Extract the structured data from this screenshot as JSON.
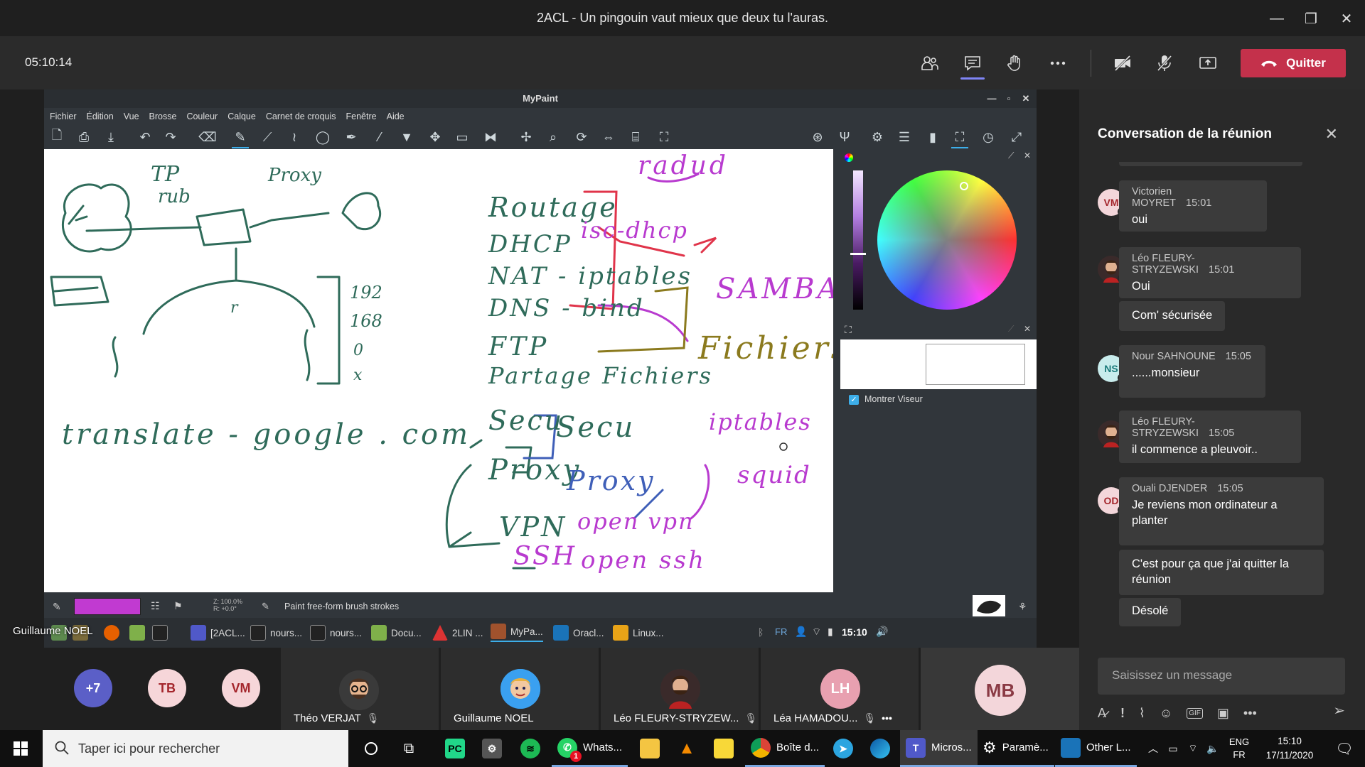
{
  "window": {
    "title": "2ACL - Un pingouin vaut mieux que deux tu l'auras.",
    "minimize_glyph": "—",
    "maximize_glyph": "❐",
    "close_glyph": "✕"
  },
  "meeting": {
    "timer": "05:10:14",
    "quit_label": "Quitter"
  },
  "mypaint": {
    "title": "MyPaint",
    "menu": [
      "Fichier",
      "Édition",
      "Vue",
      "Brosse",
      "Couleur",
      "Calque",
      "Carnet de croquis",
      "Fenêtre",
      "Aide"
    ],
    "status_text": "Paint free-form brush strokes",
    "zoom_line1": "Z: 100.0%",
    "zoom_line2": "R: +0.0°",
    "preview_checkbox_label": "Montrer Viseur",
    "brush_color": "#c13ad1",
    "canvas_text": {
      "tp": "TP",
      "rub": "rub",
      "proxy_top": "Proxy",
      "r": "r",
      "n192": "192",
      "n168": "168",
      "n0": "0",
      "nx": "x",
      "translate": "translate - google . com",
      "routage": "Routage",
      "dhcp": "DHCP",
      "nat": "NAT - iptables",
      "dns": "DNS - bind",
      "ftp": "FTP",
      "partage": "Partage Fichiers",
      "secu": "Secu",
      "proxy": "Proxy",
      "vpn": "VPN",
      "ssh": "SSH",
      "radud": "radud",
      "isc": "isc-dhcp",
      "samba": "SAMBA",
      "fichiers_samba": "Fichiers",
      "secu2": "Secu",
      "iptables2": "iptables",
      "proxy2": "Proxy",
      "squid": "squid",
      "openvpn": "open vpn",
      "openssh": "open ssh"
    },
    "taskbar": {
      "items": [
        "[2ACL...",
        "nours...",
        "nours...",
        "Docu...",
        "2LIN ...",
        "MyPa...",
        "Oracl...",
        "Linux..."
      ],
      "lang": "FR",
      "time": "15:10"
    }
  },
  "presenter": {
    "name": "Guillaume NOEL"
  },
  "chat": {
    "title": "Conversation de la réunion",
    "input_placeholder": "Saisissez un message",
    "messages": [
      {
        "initials": "VM",
        "author": "Victorien MOYRET",
        "time": "15:01",
        "text": "oui"
      },
      {
        "initials": "",
        "author": "Léo FLEURY-STRYZEWSKI",
        "time": "15:01",
        "text": "Oui",
        "followups": [
          "Com' sécurisée"
        ]
      },
      {
        "initials": "NS",
        "author": "Nour SAHNOUNE",
        "time": "15:05",
        "text": "......monsieur"
      },
      {
        "initials": "",
        "author": "Léo FLEURY-STRYZEWSKI",
        "time": "15:05",
        "text": "il commence a pleuvoir.."
      },
      {
        "initials": "OD",
        "author": "Ouali DJENDER",
        "time": "15:05",
        "text": "Je reviens mon ordinateur a planter",
        "followups": [
          "C'est pour ça que j'ai quitter la réunion",
          "Désolé"
        ]
      }
    ],
    "actions": [
      "format-icon",
      "important-icon",
      "attach-icon",
      "emoji-icon",
      "gif-icon",
      "sticker-icon",
      "more-icon"
    ]
  },
  "participants": {
    "overflow": "+7",
    "avatars": [
      "TB",
      "VM"
    ],
    "tiles": [
      {
        "name": "Théo VERJAT"
      },
      {
        "name": "Guillaume NOEL"
      },
      {
        "name": "Léo FLEURY-STRYZEW..."
      },
      {
        "name": "Léa HAMADOU...",
        "initials": "LH"
      },
      {
        "initials": "MB"
      }
    ]
  },
  "taskbar": {
    "search_placeholder": "Taper ici pour rechercher",
    "apps": [
      {
        "label": "Whats...",
        "badge": "1"
      },
      {
        "label": "Boîte d..."
      },
      {
        "label": "Micros..."
      },
      {
        "label": "Paramè..."
      },
      {
        "label": "Other L..."
      }
    ],
    "lang_top": "ENG",
    "lang_bottom": "FR",
    "time": "15:10",
    "date": "17/11/2020"
  },
  "colors": {
    "teams_red": "#c4314b",
    "teams_accent": "#7f85f5",
    "ink_green": "#2f6b5a",
    "ink_red": "#e0344a",
    "ink_purple": "#b83acf",
    "ink_olive": "#8b7a1e",
    "ink_blue": "#3f5fb8"
  }
}
